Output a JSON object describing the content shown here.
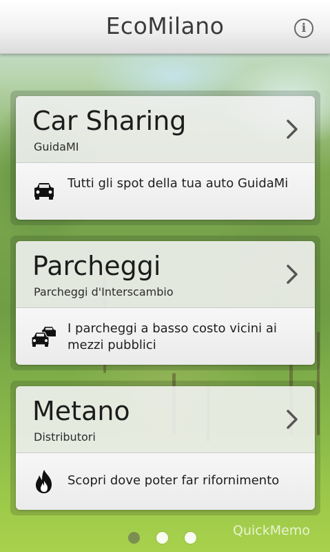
{
  "header": {
    "title": "EcoMilano",
    "info_icon": "info-icon",
    "info_glyph": "i"
  },
  "cards": [
    {
      "title": "Car Sharing",
      "subtitle": "GuidaMI",
      "icon": "car-icon",
      "description": "Tutti gli spot della tua auto GuidaMi"
    },
    {
      "title": "Parcheggi",
      "subtitle": "Parcheggi d'Interscambio",
      "icon": "parking-cars-icon",
      "description": "I parcheggi a basso costo vicini ai mezzi pubblici"
    },
    {
      "title": "Metano",
      "subtitle": "Distributori",
      "icon": "flame-icon",
      "description": "Scopri dove poter far rifornimento"
    }
  ],
  "pager": {
    "page_count": 3,
    "active_index": 0
  },
  "watermark": "QuickMemo"
}
